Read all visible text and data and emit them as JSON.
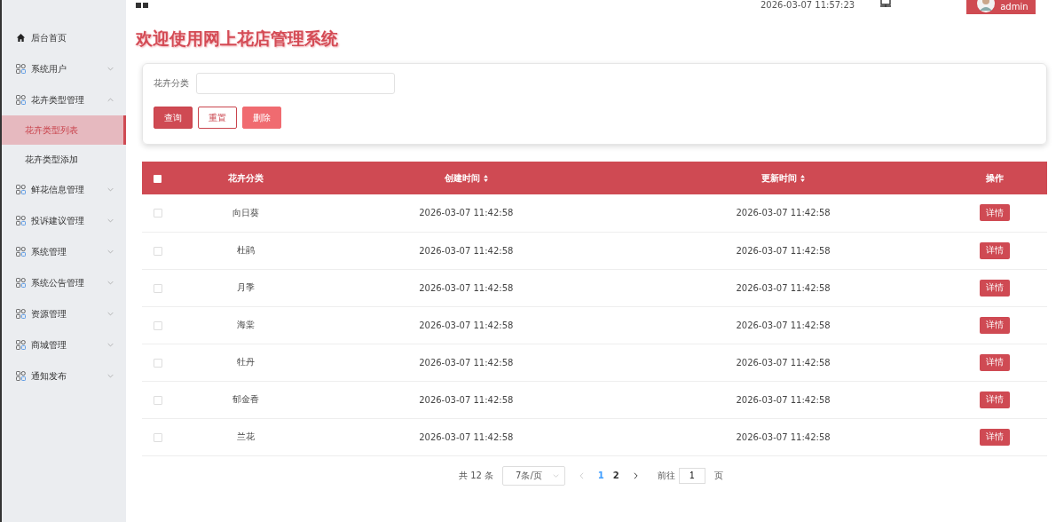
{
  "topbar": {
    "datetime": "2026-03-07 11:57:23",
    "user": "admin"
  },
  "sidebar": {
    "items": [
      {
        "kind": "home",
        "label": "后台首页"
      },
      {
        "kind": "group",
        "label": "系统用户",
        "expanded": false
      },
      {
        "kind": "group",
        "label": "花卉类型管理",
        "expanded": true,
        "children": [
          {
            "label": "花卉类型列表",
            "selected": true
          },
          {
            "label": "花卉类型添加",
            "selected": false
          }
        ]
      },
      {
        "kind": "group",
        "label": "鲜花信息管理",
        "expanded": false
      },
      {
        "kind": "group",
        "label": "投诉建议管理",
        "expanded": false
      },
      {
        "kind": "group",
        "label": "系统管理",
        "expanded": false
      },
      {
        "kind": "group",
        "label": "系统公告管理",
        "expanded": false
      },
      {
        "kind": "group",
        "label": "资源管理",
        "expanded": false
      },
      {
        "kind": "group",
        "label": "商城管理",
        "expanded": false
      },
      {
        "kind": "group",
        "label": "通知发布",
        "expanded": false
      }
    ]
  },
  "page_title": "欢迎使用网上花店管理系统",
  "filter": {
    "label": "花卉分类",
    "buttons": [
      {
        "kind": "primary",
        "label": "查询"
      },
      {
        "kind": "outline",
        "label": "重置"
      },
      {
        "kind": "danger",
        "label": "删除"
      }
    ]
  },
  "table": {
    "select_all": {
      "checked": false
    },
    "columns": [
      {
        "label": "花卉分类",
        "sortable": false
      },
      {
        "label": "创建时间",
        "sortable": true
      },
      {
        "label": "更新时间",
        "sortable": true
      },
      {
        "label": "操作",
        "sortable": false
      }
    ],
    "rows": [
      {
        "checked": false,
        "category": "向日葵",
        "created": "2026-03-07 11:42:58",
        "updated": "2026-03-07 11:42:58",
        "action": "详情"
      },
      {
        "checked": false,
        "category": "杜鹃",
        "created": "2026-03-07 11:42:58",
        "updated": "2026-03-07 11:42:58",
        "action": "详情"
      },
      {
        "checked": false,
        "category": "月季",
        "created": "2026-03-07 11:42:58",
        "updated": "2026-03-07 11:42:58",
        "action": "详情"
      },
      {
        "checked": false,
        "category": "海棠",
        "created": "2026-03-07 11:42:58",
        "updated": "2026-03-07 11:42:58",
        "action": "详情"
      },
      {
        "checked": false,
        "category": "牡丹",
        "created": "2026-03-07 11:42:58",
        "updated": "2026-03-07 11:42:58",
        "action": "详情"
      },
      {
        "checked": false,
        "category": "郁金香",
        "created": "2026-03-07 11:42:58",
        "updated": "2026-03-07 11:42:58",
        "action": "详情"
      },
      {
        "checked": false,
        "category": "兰花",
        "created": "2026-03-07 11:42:58",
        "updated": "2026-03-07 11:42:58",
        "action": "详情"
      }
    ]
  },
  "pagination": {
    "total": "共 12 条",
    "page_size": "7条/页",
    "pages": [
      {
        "label": "1",
        "selected": true
      },
      {
        "label": "2",
        "selected": false
      }
    ],
    "goto_label": "前往",
    "goto_value": "1",
    "goto_suffix": "页"
  }
}
